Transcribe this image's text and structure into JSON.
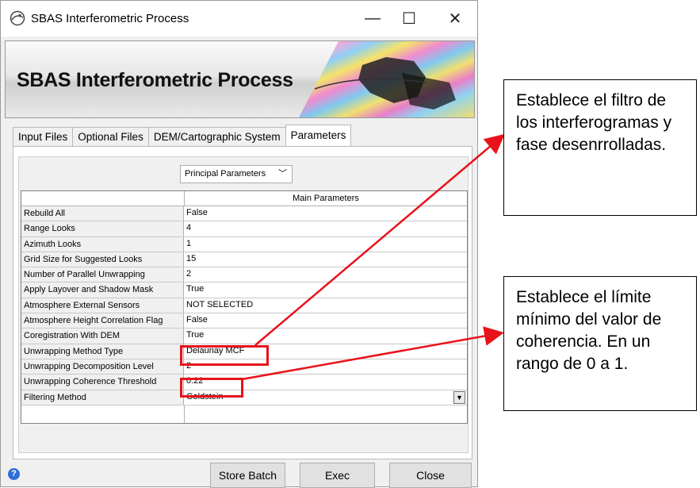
{
  "window": {
    "title": "SBAS Interferometric Process",
    "controls": {
      "minimize": "—",
      "maximize": "☐",
      "close": "✕"
    }
  },
  "banner": {
    "title": "SBAS Interferometric Process"
  },
  "tabs": [
    {
      "label": "Input Files",
      "active": false
    },
    {
      "label": "Optional Files",
      "active": false
    },
    {
      "label": "DEM/Cartographic System",
      "active": false
    },
    {
      "label": "Parameters",
      "active": true
    }
  ],
  "section_dropdown": {
    "value": "Principal Parameters",
    "icon": "chevron-down-icon"
  },
  "grid": {
    "header": "Main Parameters",
    "rows": [
      {
        "key": "Rebuild All",
        "value": "False"
      },
      {
        "key": "Range Looks",
        "value": "4"
      },
      {
        "key": "Azimuth Looks",
        "value": "1"
      },
      {
        "key": "Grid Size for Suggested Looks",
        "value": "15"
      },
      {
        "key": "Number of Parallel Unwrapping",
        "value": "2"
      },
      {
        "key": "Apply Layover and Shadow Mask",
        "value": "True"
      },
      {
        "key": "Atmosphere External Sensors",
        "value": "NOT SELECTED"
      },
      {
        "key": "Atmosphere Height Correlation Flag",
        "value": "False"
      },
      {
        "key": "Coregistration With DEM",
        "value": "True"
      },
      {
        "key": "Unwrapping Method Type",
        "value": "Delaunay MCF"
      },
      {
        "key": "Unwrapping Decomposition Level",
        "value": "2"
      },
      {
        "key": "Unwrapping Coherence Threshold",
        "value": "0.22"
      },
      {
        "key": "Filtering Method",
        "value": "Goldstein"
      }
    ]
  },
  "footer": {
    "help_icon": "?",
    "store_batch": "Store Batch",
    "exec": "Exec",
    "close": "Close"
  },
  "annotations": {
    "callout_filter": "Establece el filtro de los interferogramas y fase desenrrolladas.",
    "callout_coherence": "Establece el límite mínimo del valor de coherencia. En un rango de 0 a 1.",
    "highlight_color": "#e8131a"
  }
}
